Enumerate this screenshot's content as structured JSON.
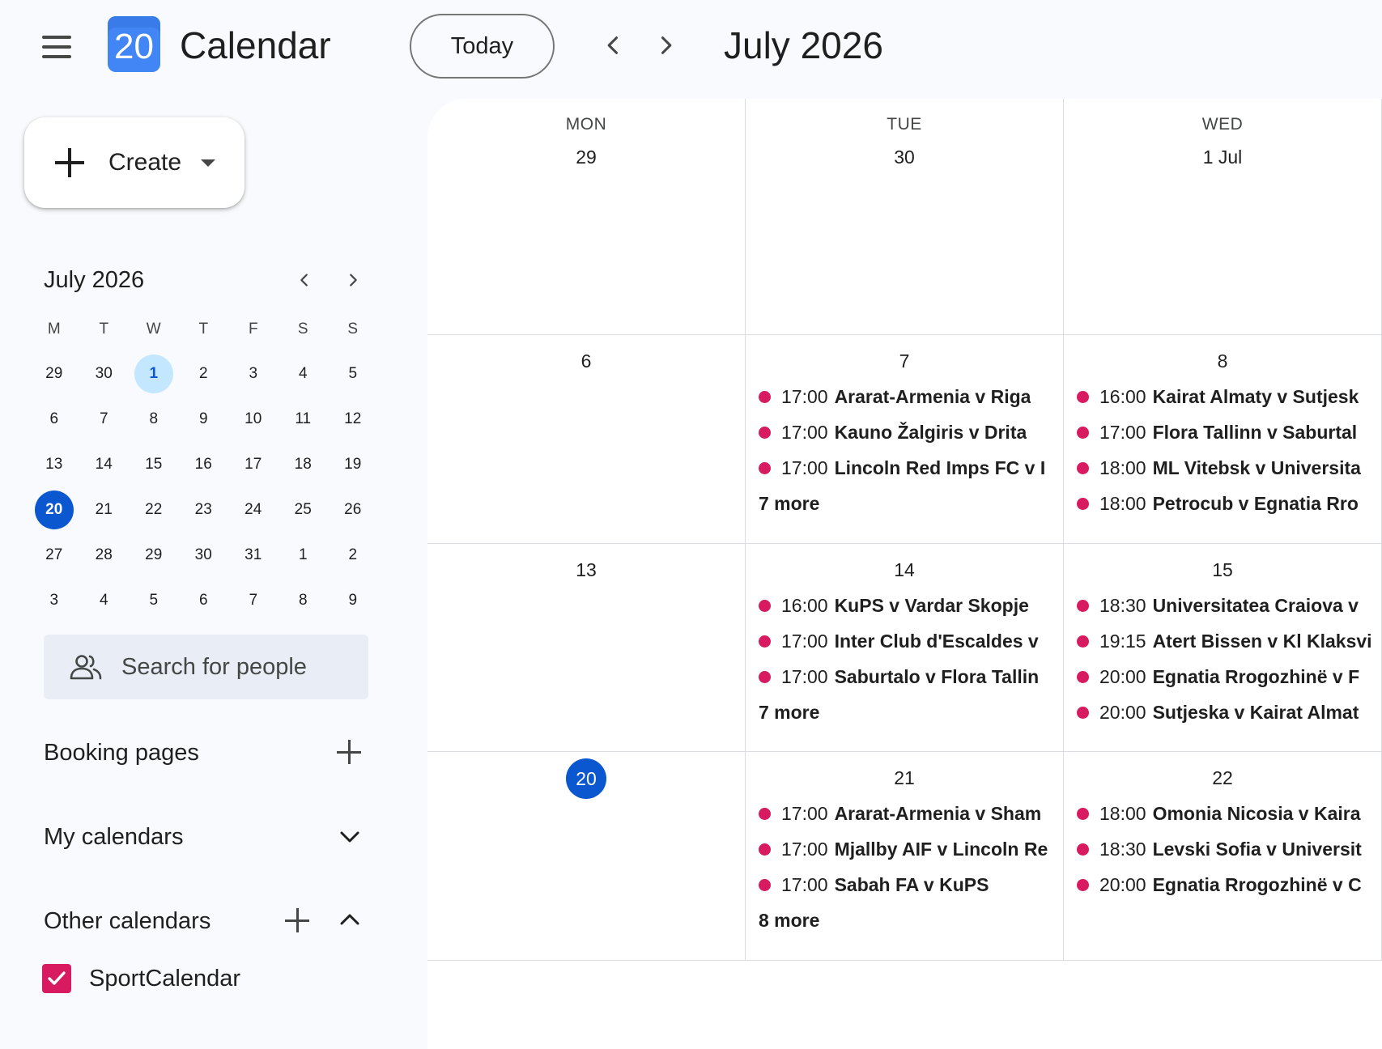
{
  "header": {
    "logo_day": "20",
    "app_title": "Calendar",
    "today_label": "Today",
    "month_title": "July 2026"
  },
  "sidebar": {
    "create_label": "Create",
    "mini_calendar": {
      "title": "July 2026",
      "weekdays": [
        "M",
        "T",
        "W",
        "T",
        "F",
        "S",
        "S"
      ],
      "weeks": [
        [
          "29",
          "30",
          "1",
          "2",
          "3",
          "4",
          "5"
        ],
        [
          "6",
          "7",
          "8",
          "9",
          "10",
          "11",
          "12"
        ],
        [
          "13",
          "14",
          "15",
          "16",
          "17",
          "18",
          "19"
        ],
        [
          "20",
          "21",
          "22",
          "23",
          "24",
          "25",
          "26"
        ],
        [
          "27",
          "28",
          "29",
          "30",
          "31",
          "1",
          "2"
        ],
        [
          "3",
          "4",
          "5",
          "6",
          "7",
          "8",
          "9"
        ]
      ],
      "selected": "1",
      "today": "20"
    },
    "search_people_placeholder": "Search for people",
    "booking_pages_label": "Booking pages",
    "my_calendars_label": "My calendars",
    "other_calendars_label": "Other calendars",
    "other_calendars": [
      {
        "name": "SportCalendar",
        "checked": true,
        "color": "#d81b60"
      }
    ]
  },
  "grid": {
    "weekdays": [
      "MON",
      "TUE",
      "WED"
    ],
    "rows": [
      {
        "cells": [
          {
            "date": "29",
            "events": [],
            "more": ""
          },
          {
            "date": "30",
            "events": [],
            "more": ""
          },
          {
            "date": "1 Jul",
            "events": [],
            "more": ""
          }
        ]
      },
      {
        "cells": [
          {
            "date": "6",
            "events": [],
            "more": ""
          },
          {
            "date": "7",
            "events": [
              {
                "time": "17:00",
                "title": "Ararat-Armenia v Riga"
              },
              {
                "time": "17:00",
                "title": "Kauno Žalgiris v Drita"
              },
              {
                "time": "17:00",
                "title": "Lincoln Red Imps FC v I"
              }
            ],
            "more": "7 more"
          },
          {
            "date": "8",
            "events": [
              {
                "time": "16:00",
                "title": "Kairat Almaty v Sutjesk"
              },
              {
                "time": "17:00",
                "title": "Flora Tallinn v Saburtal"
              },
              {
                "time": "18:00",
                "title": "ML Vitebsk v Universita"
              },
              {
                "time": "18:00",
                "title": "Petrocub v Egnatia Rro"
              }
            ],
            "more": ""
          }
        ]
      },
      {
        "cells": [
          {
            "date": "13",
            "events": [],
            "more": ""
          },
          {
            "date": "14",
            "events": [
              {
                "time": "16:00",
                "title": "KuPS v Vardar Skopje"
              },
              {
                "time": "17:00",
                "title": "Inter Club d'Escaldes v"
              },
              {
                "time": "17:00",
                "title": "Saburtalo v Flora Tallin"
              }
            ],
            "more": "7 more"
          },
          {
            "date": "15",
            "events": [
              {
                "time": "18:30",
                "title": "Universitatea Craiova v"
              },
              {
                "time": "19:15",
                "title": "Atert Bissen v Kl Klaksvi"
              },
              {
                "time": "20:00",
                "title": "Egnatia Rrogozhinë v F"
              },
              {
                "time": "20:00",
                "title": "Sutjeska v Kairat Almat"
              }
            ],
            "more": ""
          }
        ]
      },
      {
        "cells": [
          {
            "date": "20",
            "events": [],
            "more": "",
            "today": true
          },
          {
            "date": "21",
            "events": [
              {
                "time": "17:00",
                "title": "Ararat-Armenia v Sham"
              },
              {
                "time": "17:00",
                "title": "Mjallby AIF v Lincoln Re"
              },
              {
                "time": "17:00",
                "title": "Sabah FA v KuPS"
              }
            ],
            "more": "8 more"
          },
          {
            "date": "22",
            "events": [
              {
                "time": "18:00",
                "title": "Omonia Nicosia v Kaira"
              },
              {
                "time": "18:30",
                "title": "Levski Sofia v Universit"
              },
              {
                "time": "20:00",
                "title": "Egnatia Rrogozhinë v C"
              }
            ],
            "more": ""
          }
        ]
      }
    ]
  },
  "colors": {
    "event_dot": "#d81b60",
    "today_bg": "#0b57d0",
    "selected_bg": "#c2e7ff"
  }
}
